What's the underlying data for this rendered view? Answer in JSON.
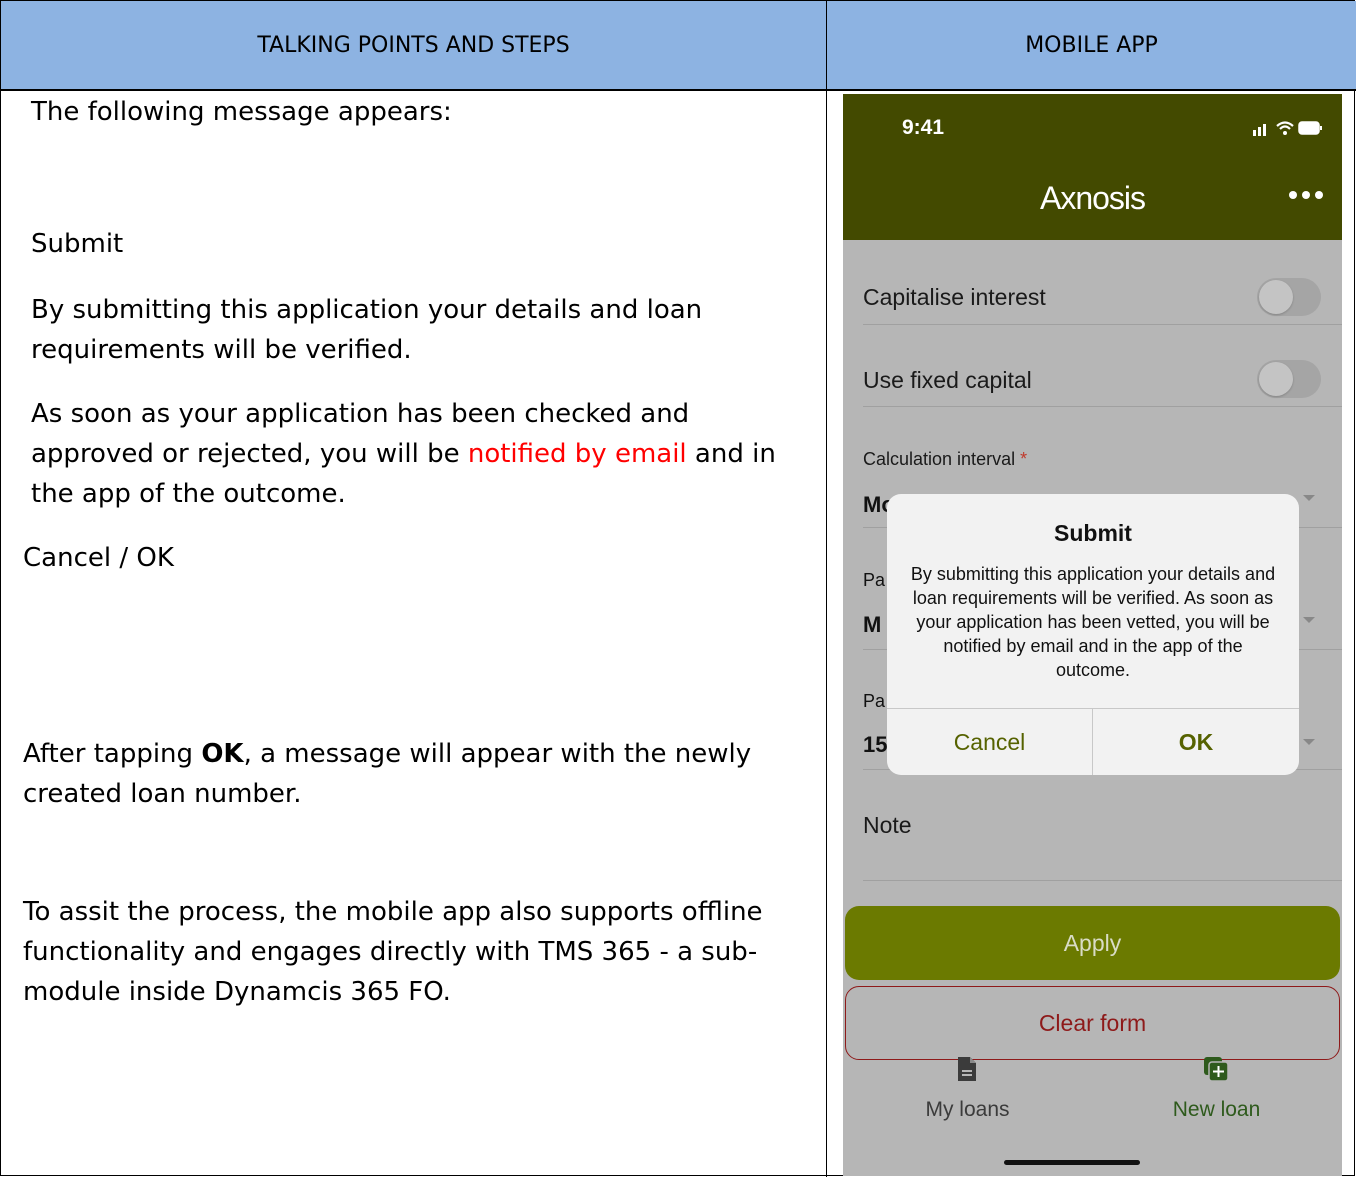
{
  "table": {
    "header_left": "TALKING POINTS AND STEPS",
    "header_right": "MOBILE APP"
  },
  "left": {
    "intro": "The following message appears:",
    "heading": "Submit",
    "p1": "By submitting this application your details and loan requirements will be verified.",
    "p2_before": "As soon as your application has been checked and approved or rejected, you will be ",
    "p2_highlight": "notified by email",
    "p2_after": " and in the app of the outcome.",
    "buttons_line": "Cancel / OK",
    "p3_before": "After tapping ",
    "p3_bold": "OK",
    "p3_after": ", a message will appear with the newly created loan number.",
    "p4": "To assit the process, the mobile app also supports offline functionality and engages directly with TMS 365 - a sub-module inside Dynamcis 365 FO.",
    "highlight_color": "#ff0000"
  },
  "phone": {
    "time": "9:41",
    "logo": "Axnosis",
    "brand_color": "#434a00",
    "fields": {
      "capitalise_interest": "Capitalise interest",
      "use_fixed_capital": "Use fixed capital",
      "calculation_interval": "Calculation interval",
      "required_mark": "*",
      "calc_value_fragment": "Mo",
      "pay_label_fragment_1": "Pa",
      "pay_value_fragment_1": "M",
      "pay_label_fragment_2": "Pa",
      "pay_value_fragment_2": "15",
      "note": "Note"
    },
    "apply_label": "Apply",
    "clear_label": "Clear form",
    "tabs": {
      "my_loans": "My loans",
      "new_loan": "New loan"
    },
    "dialog": {
      "title": "Submit",
      "message": "By submitting this application your details and loan requirements will be verified. As soon as your application has been vetted, you will be notified by email and in the app of the outcome.",
      "cancel": "Cancel",
      "ok": "OK"
    }
  }
}
